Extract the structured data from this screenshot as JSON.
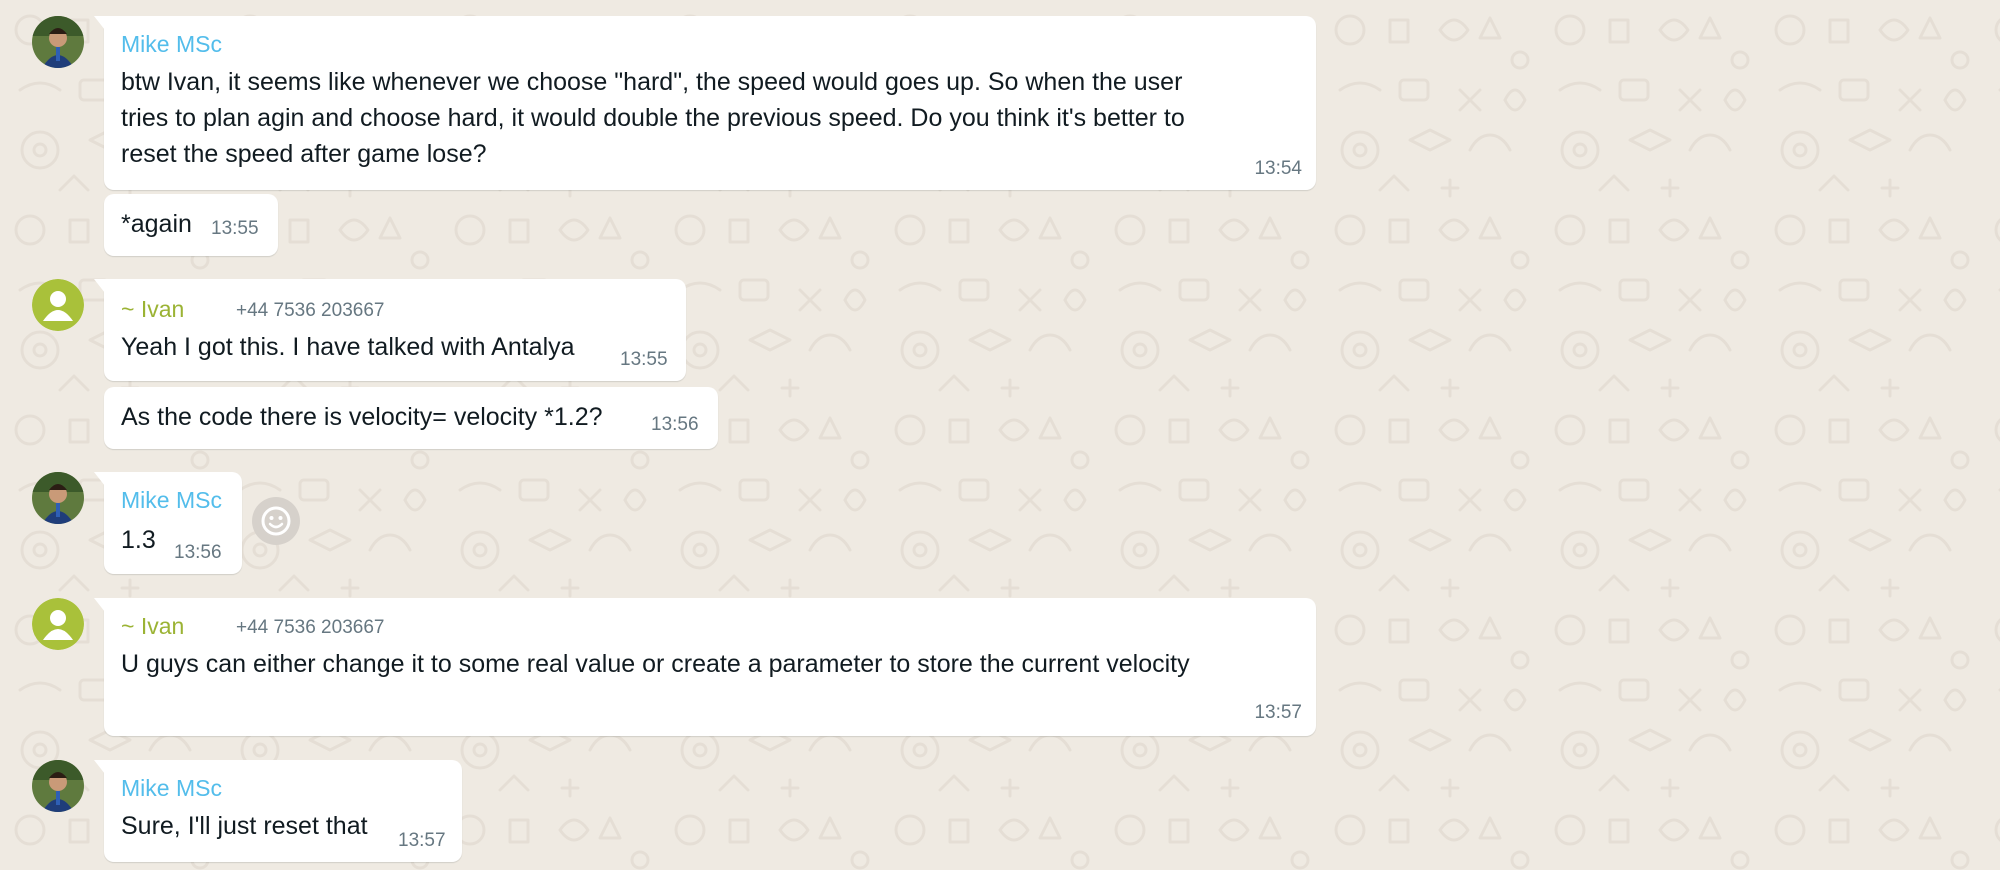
{
  "colors": {
    "chat_background": "#efeae2",
    "bubble_background": "#ffffff",
    "sender_mike": "#53bdeb",
    "sender_ivan": "#9bb334",
    "message_text": "#111b21",
    "meta_text": "#667781"
  },
  "messages": [
    {
      "sender": "Mike MSc",
      "phone": "",
      "avatar": "photo-avatar",
      "lines": [
        "btw Ivan, it seems like whenever we choose \"hard\", the speed would goes up. So when the user",
        "tries to plan agin and choose hard, it would double the previous speed. Do you think it's better to",
        "reset the speed after game lose?"
      ],
      "time": "13:54"
    },
    {
      "sender": "",
      "phone": "",
      "avatar": "",
      "lines": [
        "*again"
      ],
      "time": "13:55"
    },
    {
      "sender": "~ Ivan",
      "phone": "+44 7536 203667",
      "avatar": "default-person-avatar",
      "lines": [
        "Yeah I got this. I have talked with Antalya"
      ],
      "time": "13:55"
    },
    {
      "sender": "",
      "phone": "",
      "avatar": "",
      "lines": [
        "As the code there is velocity= velocity *1.2?"
      ],
      "time": "13:56"
    },
    {
      "sender": "Mike MSc",
      "phone": "",
      "avatar": "photo-avatar",
      "lines": [
        "1.3"
      ],
      "time": "13:56"
    },
    {
      "sender": "~ Ivan",
      "phone": "+44 7536 203667",
      "avatar": "default-person-avatar",
      "lines": [
        "U guys can either change it to some real value or create a parameter to store the current velocity"
      ],
      "time": "13:57"
    },
    {
      "sender": "Mike MSc",
      "phone": "",
      "avatar": "photo-avatar",
      "lines": [
        "Sure, I'll just reset that"
      ],
      "time": "13:57"
    }
  ],
  "reaction_icon": "smiley-face-icon"
}
